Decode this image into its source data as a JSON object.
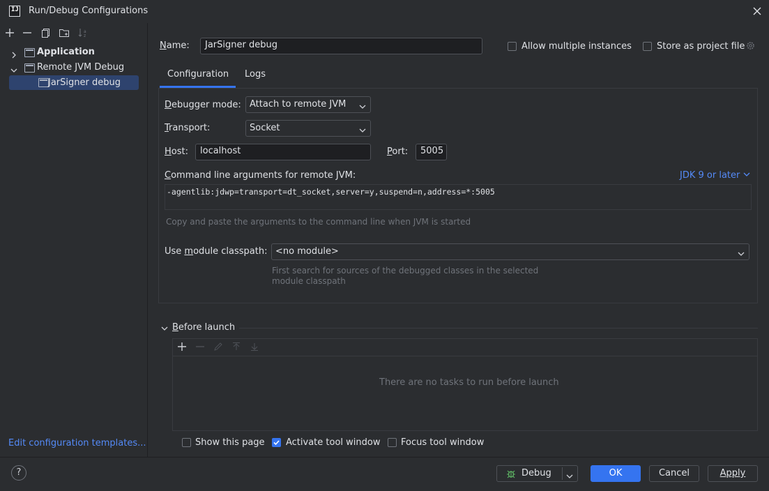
{
  "window": {
    "title": "Run/Debug Configurations",
    "app_icon_text": "IJ"
  },
  "left_toolbar": {
    "icons": [
      "add-icon",
      "remove-icon",
      "copy-icon",
      "new-folder-icon",
      "sort-icon"
    ]
  },
  "tree": {
    "items": [
      {
        "label": "Application",
        "expanded": false
      },
      {
        "label": "Remote JVM Debug",
        "expanded": true
      },
      {
        "label": "JarSigner debug",
        "selected": true
      }
    ]
  },
  "edit_templates_link": "Edit configuration templates...",
  "name_field": {
    "label": "Name:",
    "value": "JarSigner debug"
  },
  "allow_multiple": {
    "label": "Allow multiple instances",
    "checked": false
  },
  "store_as_project": {
    "label": "Store as project file",
    "checked": false
  },
  "tabs": [
    {
      "label": "Configuration",
      "active": true
    },
    {
      "label": "Logs",
      "active": false
    }
  ],
  "config": {
    "debugger_mode": {
      "label": "Debugger mode:",
      "value": "Attach to remote JVM"
    },
    "transport": {
      "label": "Transport:",
      "value": "Socket"
    },
    "host": {
      "label": "Host:",
      "value": "localhost"
    },
    "port": {
      "label": "Port:",
      "value": "5005"
    },
    "cmd_args": {
      "label": "Command line arguments for remote JVM:",
      "jdk_link": "JDK 9 or later",
      "value": "-agentlib:jdwp=transport=dt_socket,server=y,suspend=n,address=*:5005",
      "hint": "Copy and paste the arguments to the command line when JVM is started"
    },
    "module_classpath": {
      "label": "Use module classpath:",
      "value": "<no module>",
      "hint_line1": "First search for sources of the debugged classes in the selected",
      "hint_line2": "module classpath"
    }
  },
  "before_launch": {
    "title": "Before launch",
    "empty_text": "There are no tasks to run before launch",
    "toolbar_icons": [
      "add-icon",
      "remove-icon",
      "edit-icon",
      "move-up-icon",
      "move-down-icon"
    ]
  },
  "options": {
    "show_this_page": {
      "label": "Show this page",
      "checked": false
    },
    "activate_tool_window": {
      "label": "Activate tool window",
      "checked": true
    },
    "focus_tool_window": {
      "label": "Focus tool window",
      "checked": false
    }
  },
  "buttons": {
    "debug": "Debug",
    "ok": "OK",
    "cancel": "Cancel",
    "apply": "Apply",
    "help": "?"
  },
  "colors": {
    "background": "#2b2d30",
    "accent": "#3574f0",
    "link": "#548af7",
    "selection": "#2e436e"
  }
}
